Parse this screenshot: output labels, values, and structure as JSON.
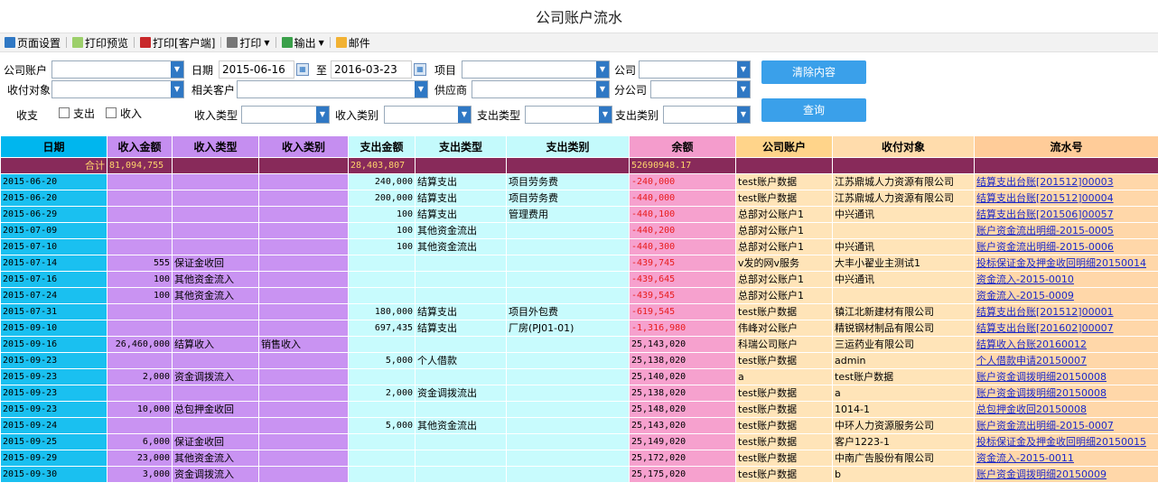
{
  "title": "公司账户流水",
  "toolbar": {
    "page_setup": "页面设置",
    "print_preview": "打印预览",
    "print_client": "打印[客户端]",
    "print": "打印",
    "export": "输出",
    "mail": "邮件"
  },
  "filters": {
    "company_account": "公司账户",
    "date": "日期",
    "date_from": "2015-06-16",
    "to": "至",
    "date_to": "2016-03-23",
    "project": "项目",
    "company": "公司",
    "payee": "收付对象",
    "related_customer": "相关客户",
    "supplier": "供应商",
    "branch": "分公司",
    "in_out": "收支",
    "expense": "支出",
    "income": "收入",
    "income_type": "收入类型",
    "income_category": "收入类别",
    "expense_type": "支出类型",
    "expense_category": "支出类别",
    "clear_button": "清除内容",
    "query_button": "查询"
  },
  "table": {
    "headers": [
      "日期",
      "收入金额",
      "收入类型",
      "收入类别",
      "支出金额",
      "支出类型",
      "支出类别",
      "余额",
      "公司账户",
      "收付对象",
      "流水号"
    ],
    "summary": {
      "label": "合计",
      "income": "81,094,755",
      "expense": "28,403,807",
      "balance": "52690948.17"
    },
    "rows": [
      [
        "2015-06-20",
        "",
        "",
        "",
        "240,000",
        "结算支出",
        "项目劳务费",
        "-240,000",
        "test账户数据",
        "江苏鼎城人力资源有限公司",
        "结算支出台账[201512]00003"
      ],
      [
        "2015-06-20",
        "",
        "",
        "",
        "200,000",
        "结算支出",
        "项目劳务费",
        "-440,000",
        "test账户数据",
        "江苏鼎城人力资源有限公司",
        "结算支出台账[201512]00004"
      ],
      [
        "2015-06-29",
        "",
        "",
        "",
        "100",
        "结算支出",
        "管理费用",
        "-440,100",
        "总部对公账户1",
        "中兴通讯",
        "结算支出台账[201506]00057"
      ],
      [
        "2015-07-09",
        "",
        "",
        "",
        "100",
        "其他资金流出",
        "",
        "-440,200",
        "总部对公账户1",
        "",
        "账户资金流出明细-2015-0005"
      ],
      [
        "2015-07-10",
        "",
        "",
        "",
        "100",
        "其他资金流出",
        "",
        "-440,300",
        "总部对公账户1",
        "中兴通讯",
        "账户资金流出明细-2015-0006"
      ],
      [
        "2015-07-14",
        "555",
        "保证金收回",
        "",
        "",
        "",
        "",
        "-439,745",
        "v发的网v服务",
        "大丰小翟业主测试1",
        "投标保证金及押金收回明细20150014"
      ],
      [
        "2015-07-16",
        "100",
        "其他资金流入",
        "",
        "",
        "",
        "",
        "-439,645",
        "总部对公账户1",
        "中兴通讯",
        "资金流入-2015-0010"
      ],
      [
        "2015-07-24",
        "100",
        "其他资金流入",
        "",
        "",
        "",
        "",
        "-439,545",
        "总部对公账户1",
        "",
        "资金流入-2015-0009"
      ],
      [
        "2015-07-31",
        "",
        "",
        "",
        "180,000",
        "结算支出",
        "项目外包费",
        "-619,545",
        "test账户数据",
        "镇江北新建材有限公司",
        "结算支出台账[201512]00001"
      ],
      [
        "2015-09-10",
        "",
        "",
        "",
        "697,435",
        "结算支出",
        "厂房(PJ01-01)",
        "-1,316,980",
        "伟峰对公账户",
        "精锐钢材制品有限公司",
        "结算支出台账[201602]00007"
      ],
      [
        "2015-09-16",
        "26,460,000",
        "结算收入",
        "销售收入",
        "",
        "",
        "",
        "25,143,020",
        "科瑞公司账户",
        "三运药业有限公司",
        "结算收入台账20160012"
      ],
      [
        "2015-09-23",
        "",
        "",
        "",
        "5,000",
        "个人借款",
        "",
        "25,138,020",
        "test账户数据",
        "admin",
        "个人借款申请20150007"
      ],
      [
        "2015-09-23",
        "2,000",
        "资金调拨流入",
        "",
        "",
        "",
        "",
        "25,140,020",
        "a",
        "test账户数据",
        "账户资金调拨明细20150008"
      ],
      [
        "2015-09-23",
        "",
        "",
        "",
        "2,000",
        "资金调拨流出",
        "",
        "25,138,020",
        "test账户数据",
        "a",
        "账户资金调拨明细20150008"
      ],
      [
        "2015-09-23",
        "10,000",
        "总包押金收回",
        "",
        "",
        "",
        "",
        "25,148,020",
        "test账户数据",
        "1014-1",
        "总包押金收回20150008"
      ],
      [
        "2015-09-24",
        "",
        "",
        "",
        "5,000",
        "其他资金流出",
        "",
        "25,143,020",
        "test账户数据",
        "中环人力资源服务公司",
        "账户资金流出明细-2015-0007"
      ],
      [
        "2015-09-25",
        "6,000",
        "保证金收回",
        "",
        "",
        "",
        "",
        "25,149,020",
        "test账户数据",
        "客户1223-1",
        "投标保证金及押金收回明细20150015"
      ],
      [
        "2015-09-29",
        "23,000",
        "其他资金流入",
        "",
        "",
        "",
        "",
        "25,172,020",
        "test账户数据",
        "中南广告股份有限公司",
        "资金流入-2015-0011"
      ],
      [
        "2015-09-30",
        "3,000",
        "资金调拨流入",
        "",
        "",
        "",
        "",
        "25,175,020",
        "test账户数据",
        "b",
        "账户资金调拨明细20150009"
      ]
    ]
  },
  "colors": {
    "date_col": "#1ac0f0",
    "income_cols": "#c993f2",
    "expense_cols": "#c8fbfd",
    "balance_col": "#f6a1ce",
    "summary_row": "#882a5a",
    "negative": "#e81c1c",
    "button": "#3aa0ea"
  }
}
